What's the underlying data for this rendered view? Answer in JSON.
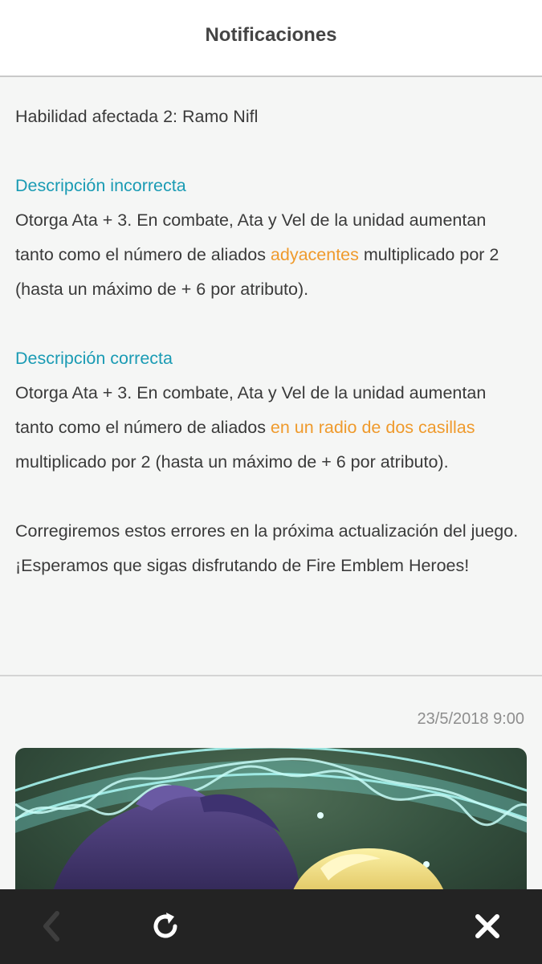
{
  "header": {
    "title": "Notificaciones"
  },
  "notification": {
    "affected_skill": "Habilidad afectada 2: Ramo Nifl",
    "incorrect": {
      "heading": "Descripción incorrecta",
      "text_before": "Otorga Ata + 3. En combate, Ata y Vel de la unidad aumentan tanto como el número de aliados ",
      "highlight": "adyacentes",
      "text_after": " multiplicado por 2 (hasta un máximo de + 6 por atributo)."
    },
    "correct": {
      "heading": "Descripción correcta",
      "text_before": "Otorga Ata + 3. En combate, Ata y Vel de la unidad aumentan tanto como el número de aliados ",
      "highlight": "en un radio de dos casillas",
      "text_after": " multiplicado por 2 (hasta un máximo de + 6 por atributo)."
    },
    "closing_1": "Corregiremos estos errores en la próxima actualización del juego.",
    "closing_2": "¡Esperamos que sigas disfrutando de Fire Emblem Heroes!"
  },
  "next_notification": {
    "timestamp": "23/5/2018 9:00"
  },
  "toolbar": {
    "back_icon": "chevron-left-icon",
    "refresh_icon": "refresh-icon",
    "close_icon": "close-icon"
  },
  "colors": {
    "heading": "#1a9bb4",
    "highlight": "#ef9a2c",
    "toolbar": "#232323"
  }
}
